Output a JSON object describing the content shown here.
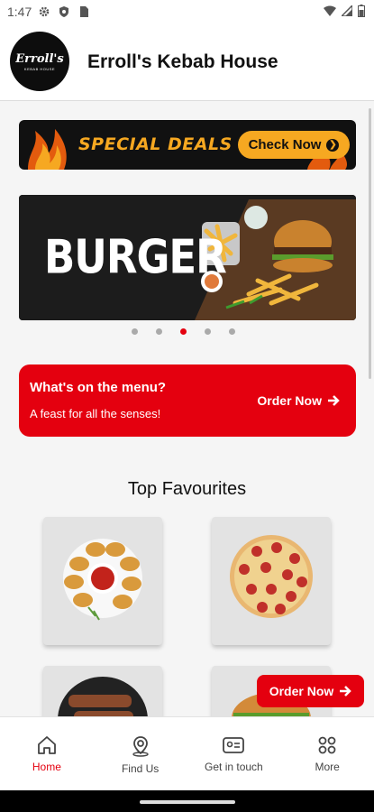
{
  "status_bar": {
    "time": "1:47"
  },
  "header": {
    "logo_text": "Erroll's",
    "logo_subtext": "KEBAB HOUSE",
    "title": "Erroll's Kebab House"
  },
  "deals": {
    "label": "SPECIAL DEALS",
    "button": "Check Now"
  },
  "banner": {
    "text": "BURGER",
    "slide_count": 5,
    "active_slide": 3
  },
  "menu_card": {
    "title": "What's on the menu?",
    "subtitle": "A feast for all the senses!",
    "action": "Order Now"
  },
  "favourites": {
    "title": "Top Favourites",
    "items": [
      {
        "name": "nuggets",
        "icon": "nuggets-image"
      },
      {
        "name": "pizza",
        "icon": "pizza-image"
      },
      {
        "name": "skewers",
        "icon": "skewers-image"
      },
      {
        "name": "burger",
        "icon": "burger-image"
      }
    ]
  },
  "floating_button": {
    "label": "Order Now"
  },
  "nav": {
    "items": [
      {
        "label": "Home",
        "icon": "home-icon",
        "active": true
      },
      {
        "label": "Find Us",
        "icon": "location-icon",
        "active": false
      },
      {
        "label": "Get in touch",
        "icon": "contact-card-icon",
        "active": false
      },
      {
        "label": "More",
        "icon": "more-icon",
        "active": false
      }
    ]
  },
  "colors": {
    "brand_red": "#e4000f",
    "deals_orange": "#f6a821"
  }
}
